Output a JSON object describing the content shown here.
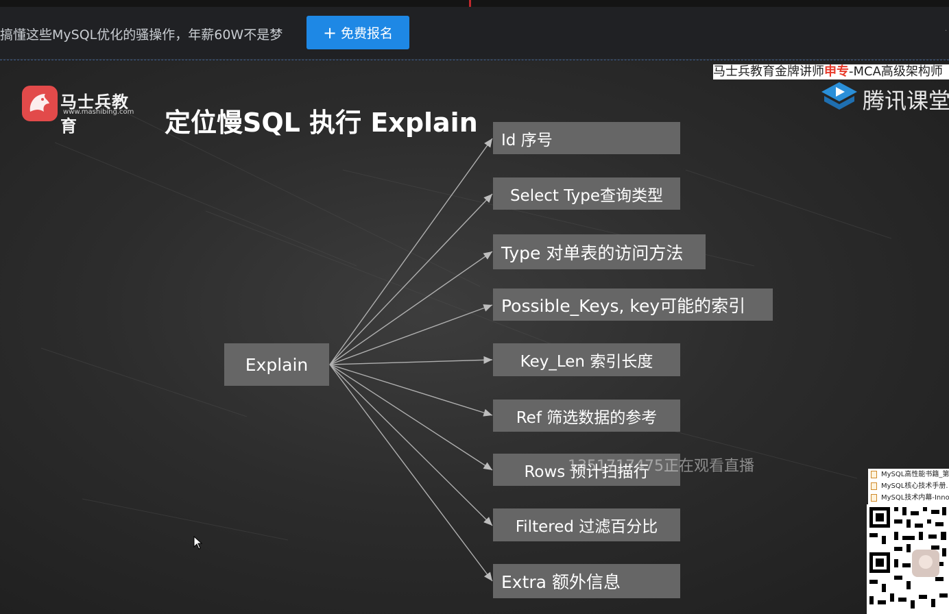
{
  "header": {
    "promo_text": "搞懂这些MySQL优化的骚操作，年薪60W不是梦",
    "signup_button": "免费报名",
    "signup_icon": "plus-icon"
  },
  "slide": {
    "logo_name": "马士兵教育",
    "logo_url": "www.mashibing.com",
    "title": "定位慢SQL 执行 Explain",
    "root": "Explain",
    "items": [
      "Id 序号",
      "Select Type查询类型",
      "Type 对单表的访问方法",
      "Possible_Keys, key可能的索引",
      "Key_Len  索引长度",
      "Ref 筛选数据的参考",
      "Rows 预计扫描行",
      "Filtered 过滤百分比",
      "Extra 额外信息"
    ]
  },
  "overlay": {
    "tagline_prefix": "马士兵教育金牌讲师",
    "tagline_highlight": "申专",
    "tagline_suffix": "-MCA高级架构师",
    "brand": "腾讯课堂",
    "watermark": "1351717475正在观看直播",
    "files": [
      "MySQL高性能书籍_第",
      "MySQL核心技术手册.",
      "MySQL技术内幕-Inno"
    ]
  },
  "colors": {
    "button_blue": "#1e88e5",
    "node_gray": "#666666",
    "highlight_red": "#e83a2a"
  }
}
